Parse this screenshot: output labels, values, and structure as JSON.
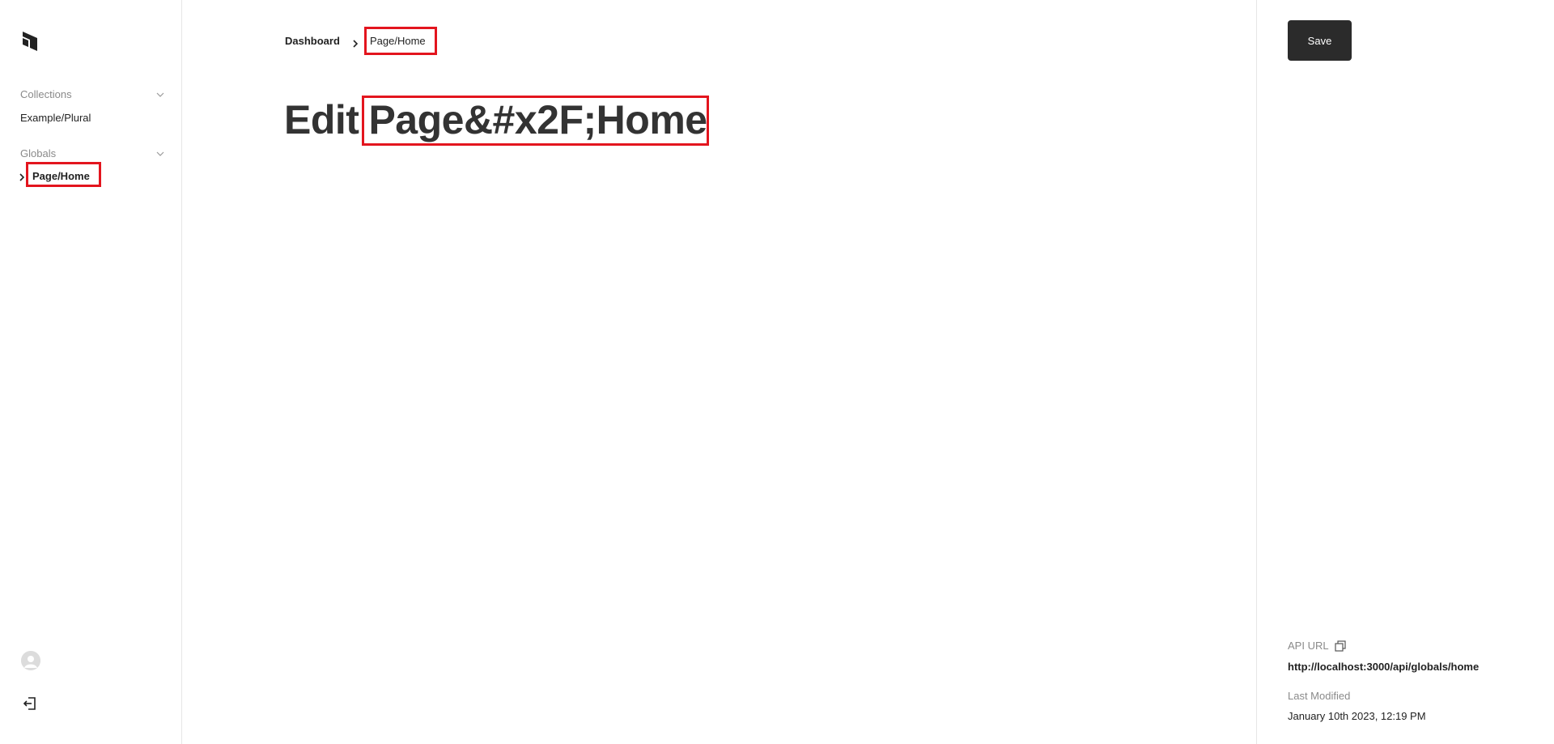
{
  "sidebar": {
    "logo_icon": "payload-logo-icon",
    "groups": [
      {
        "title": "Collections",
        "items": [
          {
            "label": "Example/Plural",
            "active": false
          }
        ]
      },
      {
        "title": "Globals",
        "items": [
          {
            "label": "Page/Home",
            "active": true
          }
        ]
      }
    ],
    "account_icon": "user-avatar-icon",
    "logout_icon": "logout-icon"
  },
  "breadcrumb": {
    "root": "Dashboard",
    "current": "Page/Home"
  },
  "main": {
    "title_prefix": "Edit",
    "title_entity": "Page&#x2F;Home"
  },
  "right_panel": {
    "save_label": "Save",
    "api_url_label": "API URL",
    "api_url_value": "http://localhost:3000/api/globals/home",
    "last_modified_label": "Last Modified",
    "last_modified_value": "January 10th 2023, 12:19 PM"
  },
  "colors": {
    "highlight": "#e3151e",
    "button_bg": "#2b2b2b",
    "border": "#e6e6e6"
  }
}
